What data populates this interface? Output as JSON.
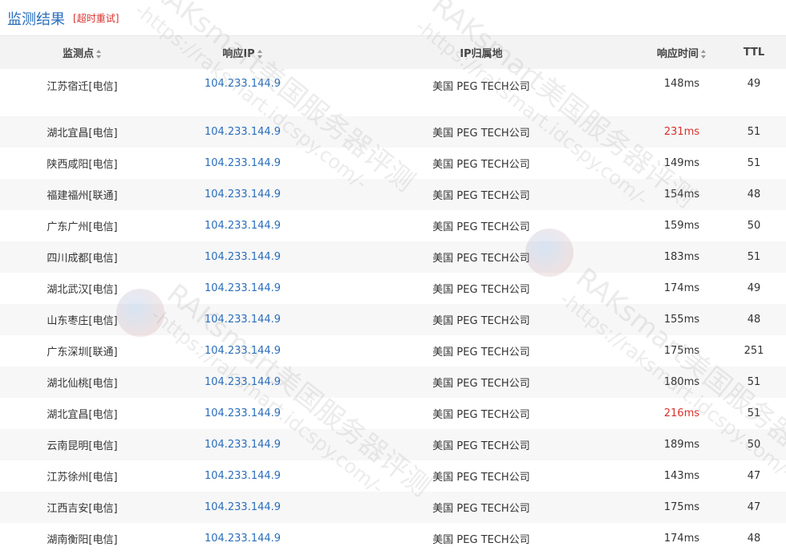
{
  "header": {
    "title": "监测结果",
    "retry_label": "超时重试"
  },
  "table": {
    "columns": {
      "node": "监测点",
      "ip": "响应IP",
      "location": "IP归属地",
      "time": "响应时间",
      "ttl": "TTL"
    },
    "rows": [
      {
        "node": "江苏宿迁[电信]",
        "ip": "104.233.144.9",
        "location": "美国 PEG TECH公司",
        "time": "148ms",
        "ttl": "49",
        "slow": false
      },
      {
        "node": "湖北宜昌[电信]",
        "ip": "104.233.144.9",
        "location": "美国 PEG TECH公司",
        "time": "231ms",
        "ttl": "51",
        "slow": true
      },
      {
        "node": "陕西咸阳[电信]",
        "ip": "104.233.144.9",
        "location": "美国 PEG TECH公司",
        "time": "149ms",
        "ttl": "51",
        "slow": false
      },
      {
        "node": "福建福州[联通]",
        "ip": "104.233.144.9",
        "location": "美国 PEG TECH公司",
        "time": "154ms",
        "ttl": "48",
        "slow": false
      },
      {
        "node": "广东广州[电信]",
        "ip": "104.233.144.9",
        "location": "美国 PEG TECH公司",
        "time": "159ms",
        "ttl": "50",
        "slow": false
      },
      {
        "node": "四川成都[电信]",
        "ip": "104.233.144.9",
        "location": "美国 PEG TECH公司",
        "time": "183ms",
        "ttl": "51",
        "slow": false
      },
      {
        "node": "湖北武汉[电信]",
        "ip": "104.233.144.9",
        "location": "美国 PEG TECH公司",
        "time": "174ms",
        "ttl": "49",
        "slow": false
      },
      {
        "node": "山东枣庄[电信]",
        "ip": "104.233.144.9",
        "location": "美国 PEG TECH公司",
        "time": "155ms",
        "ttl": "48",
        "slow": false
      },
      {
        "node": "广东深圳[联通]",
        "ip": "104.233.144.9",
        "location": "美国 PEG TECH公司",
        "time": "175ms",
        "ttl": "251",
        "slow": false
      },
      {
        "node": "湖北仙桃[电信]",
        "ip": "104.233.144.9",
        "location": "美国 PEG TECH公司",
        "time": "180ms",
        "ttl": "51",
        "slow": false
      },
      {
        "node": "湖北宜昌[电信]",
        "ip": "104.233.144.9",
        "location": "美国 PEG TECH公司",
        "time": "216ms",
        "ttl": "51",
        "slow": true
      },
      {
        "node": "云南昆明[电信]",
        "ip": "104.233.144.9",
        "location": "美国 PEG TECH公司",
        "time": "189ms",
        "ttl": "50",
        "slow": false
      },
      {
        "node": "江苏徐州[电信]",
        "ip": "104.233.144.9",
        "location": "美国 PEG TECH公司",
        "time": "143ms",
        "ttl": "47",
        "slow": false
      },
      {
        "node": "江西吉安[电信]",
        "ip": "104.233.144.9",
        "location": "美国 PEG TECH公司",
        "time": "175ms",
        "ttl": "47",
        "slow": false
      },
      {
        "node": "湖南衡阳[电信]",
        "ip": "104.233.144.9",
        "location": "美国 PEG TECH公司",
        "time": "174ms",
        "ttl": "48",
        "slow": false
      }
    ]
  },
  "watermark": {
    "text": "RAKsmart美国服务器评测",
    "url": "-https://raksmart.idcspy.com/-"
  },
  "colors": {
    "link": "#2a6ebd",
    "slow": "#d9302c",
    "header_bg": "#f3f3f3",
    "stripe": "#f7f7f7"
  }
}
